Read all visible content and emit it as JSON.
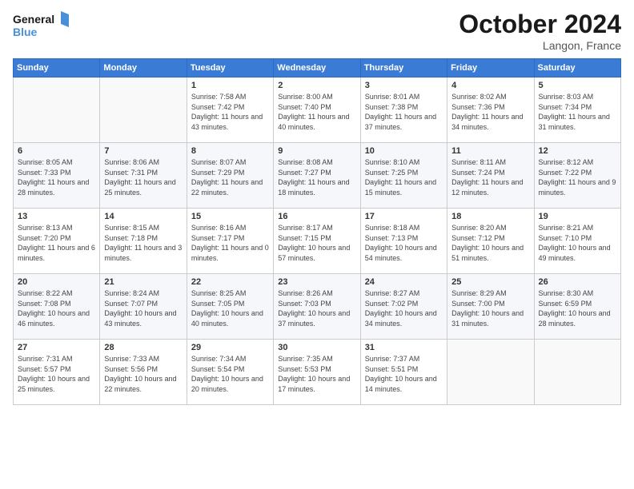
{
  "logo": {
    "line1": "General",
    "line2": "Blue"
  },
  "title": "October 2024",
  "location": "Langon, France",
  "days_header": [
    "Sunday",
    "Monday",
    "Tuesday",
    "Wednesday",
    "Thursday",
    "Friday",
    "Saturday"
  ],
  "weeks": [
    [
      {
        "day": "",
        "sunrise": "",
        "sunset": "",
        "daylight": ""
      },
      {
        "day": "",
        "sunrise": "",
        "sunset": "",
        "daylight": ""
      },
      {
        "day": "1",
        "sunrise": "Sunrise: 7:58 AM",
        "sunset": "Sunset: 7:42 PM",
        "daylight": "Daylight: 11 hours and 43 minutes."
      },
      {
        "day": "2",
        "sunrise": "Sunrise: 8:00 AM",
        "sunset": "Sunset: 7:40 PM",
        "daylight": "Daylight: 11 hours and 40 minutes."
      },
      {
        "day": "3",
        "sunrise": "Sunrise: 8:01 AM",
        "sunset": "Sunset: 7:38 PM",
        "daylight": "Daylight: 11 hours and 37 minutes."
      },
      {
        "day": "4",
        "sunrise": "Sunrise: 8:02 AM",
        "sunset": "Sunset: 7:36 PM",
        "daylight": "Daylight: 11 hours and 34 minutes."
      },
      {
        "day": "5",
        "sunrise": "Sunrise: 8:03 AM",
        "sunset": "Sunset: 7:34 PM",
        "daylight": "Daylight: 11 hours and 31 minutes."
      }
    ],
    [
      {
        "day": "6",
        "sunrise": "Sunrise: 8:05 AM",
        "sunset": "Sunset: 7:33 PM",
        "daylight": "Daylight: 11 hours and 28 minutes."
      },
      {
        "day": "7",
        "sunrise": "Sunrise: 8:06 AM",
        "sunset": "Sunset: 7:31 PM",
        "daylight": "Daylight: 11 hours and 25 minutes."
      },
      {
        "day": "8",
        "sunrise": "Sunrise: 8:07 AM",
        "sunset": "Sunset: 7:29 PM",
        "daylight": "Daylight: 11 hours and 22 minutes."
      },
      {
        "day": "9",
        "sunrise": "Sunrise: 8:08 AM",
        "sunset": "Sunset: 7:27 PM",
        "daylight": "Daylight: 11 hours and 18 minutes."
      },
      {
        "day": "10",
        "sunrise": "Sunrise: 8:10 AM",
        "sunset": "Sunset: 7:25 PM",
        "daylight": "Daylight: 11 hours and 15 minutes."
      },
      {
        "day": "11",
        "sunrise": "Sunrise: 8:11 AM",
        "sunset": "Sunset: 7:24 PM",
        "daylight": "Daylight: 11 hours and 12 minutes."
      },
      {
        "day": "12",
        "sunrise": "Sunrise: 8:12 AM",
        "sunset": "Sunset: 7:22 PM",
        "daylight": "Daylight: 11 hours and 9 minutes."
      }
    ],
    [
      {
        "day": "13",
        "sunrise": "Sunrise: 8:13 AM",
        "sunset": "Sunset: 7:20 PM",
        "daylight": "Daylight: 11 hours and 6 minutes."
      },
      {
        "day": "14",
        "sunrise": "Sunrise: 8:15 AM",
        "sunset": "Sunset: 7:18 PM",
        "daylight": "Daylight: 11 hours and 3 minutes."
      },
      {
        "day": "15",
        "sunrise": "Sunrise: 8:16 AM",
        "sunset": "Sunset: 7:17 PM",
        "daylight": "Daylight: 11 hours and 0 minutes."
      },
      {
        "day": "16",
        "sunrise": "Sunrise: 8:17 AM",
        "sunset": "Sunset: 7:15 PM",
        "daylight": "Daylight: 10 hours and 57 minutes."
      },
      {
        "day": "17",
        "sunrise": "Sunrise: 8:18 AM",
        "sunset": "Sunset: 7:13 PM",
        "daylight": "Daylight: 10 hours and 54 minutes."
      },
      {
        "day": "18",
        "sunrise": "Sunrise: 8:20 AM",
        "sunset": "Sunset: 7:12 PM",
        "daylight": "Daylight: 10 hours and 51 minutes."
      },
      {
        "day": "19",
        "sunrise": "Sunrise: 8:21 AM",
        "sunset": "Sunset: 7:10 PM",
        "daylight": "Daylight: 10 hours and 49 minutes."
      }
    ],
    [
      {
        "day": "20",
        "sunrise": "Sunrise: 8:22 AM",
        "sunset": "Sunset: 7:08 PM",
        "daylight": "Daylight: 10 hours and 46 minutes."
      },
      {
        "day": "21",
        "sunrise": "Sunrise: 8:24 AM",
        "sunset": "Sunset: 7:07 PM",
        "daylight": "Daylight: 10 hours and 43 minutes."
      },
      {
        "day": "22",
        "sunrise": "Sunrise: 8:25 AM",
        "sunset": "Sunset: 7:05 PM",
        "daylight": "Daylight: 10 hours and 40 minutes."
      },
      {
        "day": "23",
        "sunrise": "Sunrise: 8:26 AM",
        "sunset": "Sunset: 7:03 PM",
        "daylight": "Daylight: 10 hours and 37 minutes."
      },
      {
        "day": "24",
        "sunrise": "Sunrise: 8:27 AM",
        "sunset": "Sunset: 7:02 PM",
        "daylight": "Daylight: 10 hours and 34 minutes."
      },
      {
        "day": "25",
        "sunrise": "Sunrise: 8:29 AM",
        "sunset": "Sunset: 7:00 PM",
        "daylight": "Daylight: 10 hours and 31 minutes."
      },
      {
        "day": "26",
        "sunrise": "Sunrise: 8:30 AM",
        "sunset": "Sunset: 6:59 PM",
        "daylight": "Daylight: 10 hours and 28 minutes."
      }
    ],
    [
      {
        "day": "27",
        "sunrise": "Sunrise: 7:31 AM",
        "sunset": "Sunset: 5:57 PM",
        "daylight": "Daylight: 10 hours and 25 minutes."
      },
      {
        "day": "28",
        "sunrise": "Sunrise: 7:33 AM",
        "sunset": "Sunset: 5:56 PM",
        "daylight": "Daylight: 10 hours and 22 minutes."
      },
      {
        "day": "29",
        "sunrise": "Sunrise: 7:34 AM",
        "sunset": "Sunset: 5:54 PM",
        "daylight": "Daylight: 10 hours and 20 minutes."
      },
      {
        "day": "30",
        "sunrise": "Sunrise: 7:35 AM",
        "sunset": "Sunset: 5:53 PM",
        "daylight": "Daylight: 10 hours and 17 minutes."
      },
      {
        "day": "31",
        "sunrise": "Sunrise: 7:37 AM",
        "sunset": "Sunset: 5:51 PM",
        "daylight": "Daylight: 10 hours and 14 minutes."
      },
      {
        "day": "",
        "sunrise": "",
        "sunset": "",
        "daylight": ""
      },
      {
        "day": "",
        "sunrise": "",
        "sunset": "",
        "daylight": ""
      }
    ]
  ]
}
